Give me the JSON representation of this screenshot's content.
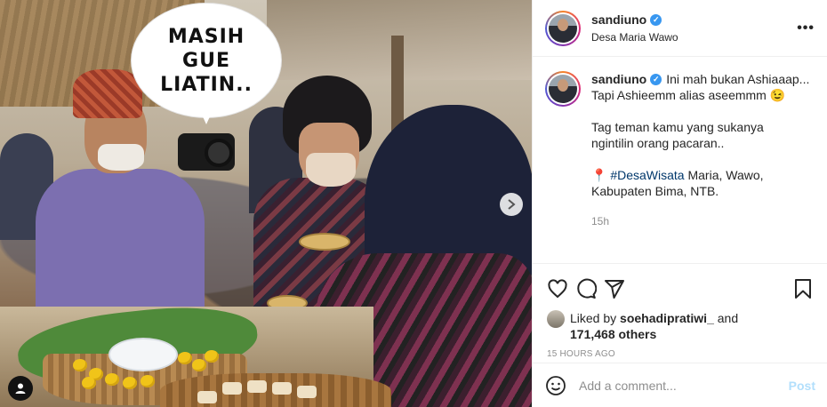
{
  "photo": {
    "speech_bubble": [
      "MASIH",
      "GUE",
      "LIATIN.."
    ],
    "next_icon": "chevron-right-icon",
    "tag_icon": "user-tag-icon"
  },
  "header": {
    "username": "sandiuno",
    "location": "Desa Maria Wawo",
    "more_icon": "more-icon",
    "more_label": "•••"
  },
  "caption": {
    "username": "sandiuno",
    "line1": "Ini mah bukan Ashiaaap...",
    "line2": "Tapi Ashieemm alias aseemmm 😉",
    "line3": "Tag teman kamu yang sukanya",
    "line4": "ngintilin orang pacaran..",
    "pin_icon": "📍",
    "hashtag": "#DesaWisata",
    "line5_rest": " Maria, Wawo,",
    "line6": "Kabupaten Bima, NTB.",
    "time": "15h"
  },
  "actions": {
    "like_icon": "heart-icon",
    "comment_icon": "comment-icon",
    "share_icon": "share-icon",
    "save_icon": "bookmark-icon",
    "liked_by_prefix": "Liked by",
    "liked_by_user": "soehadipratiwi_",
    "liked_by_and": "and",
    "others_count": "171,468 others",
    "posted_ago": "15 HOURS AGO"
  },
  "comment": {
    "emoji_icon": "smiley-icon",
    "placeholder": "Add a comment...",
    "post_label": "Post"
  },
  "colors": {
    "verified": "#3897f0",
    "hashtag": "#00376b",
    "post_disabled": "#b2dffc",
    "muted": "#8e8e8e"
  }
}
